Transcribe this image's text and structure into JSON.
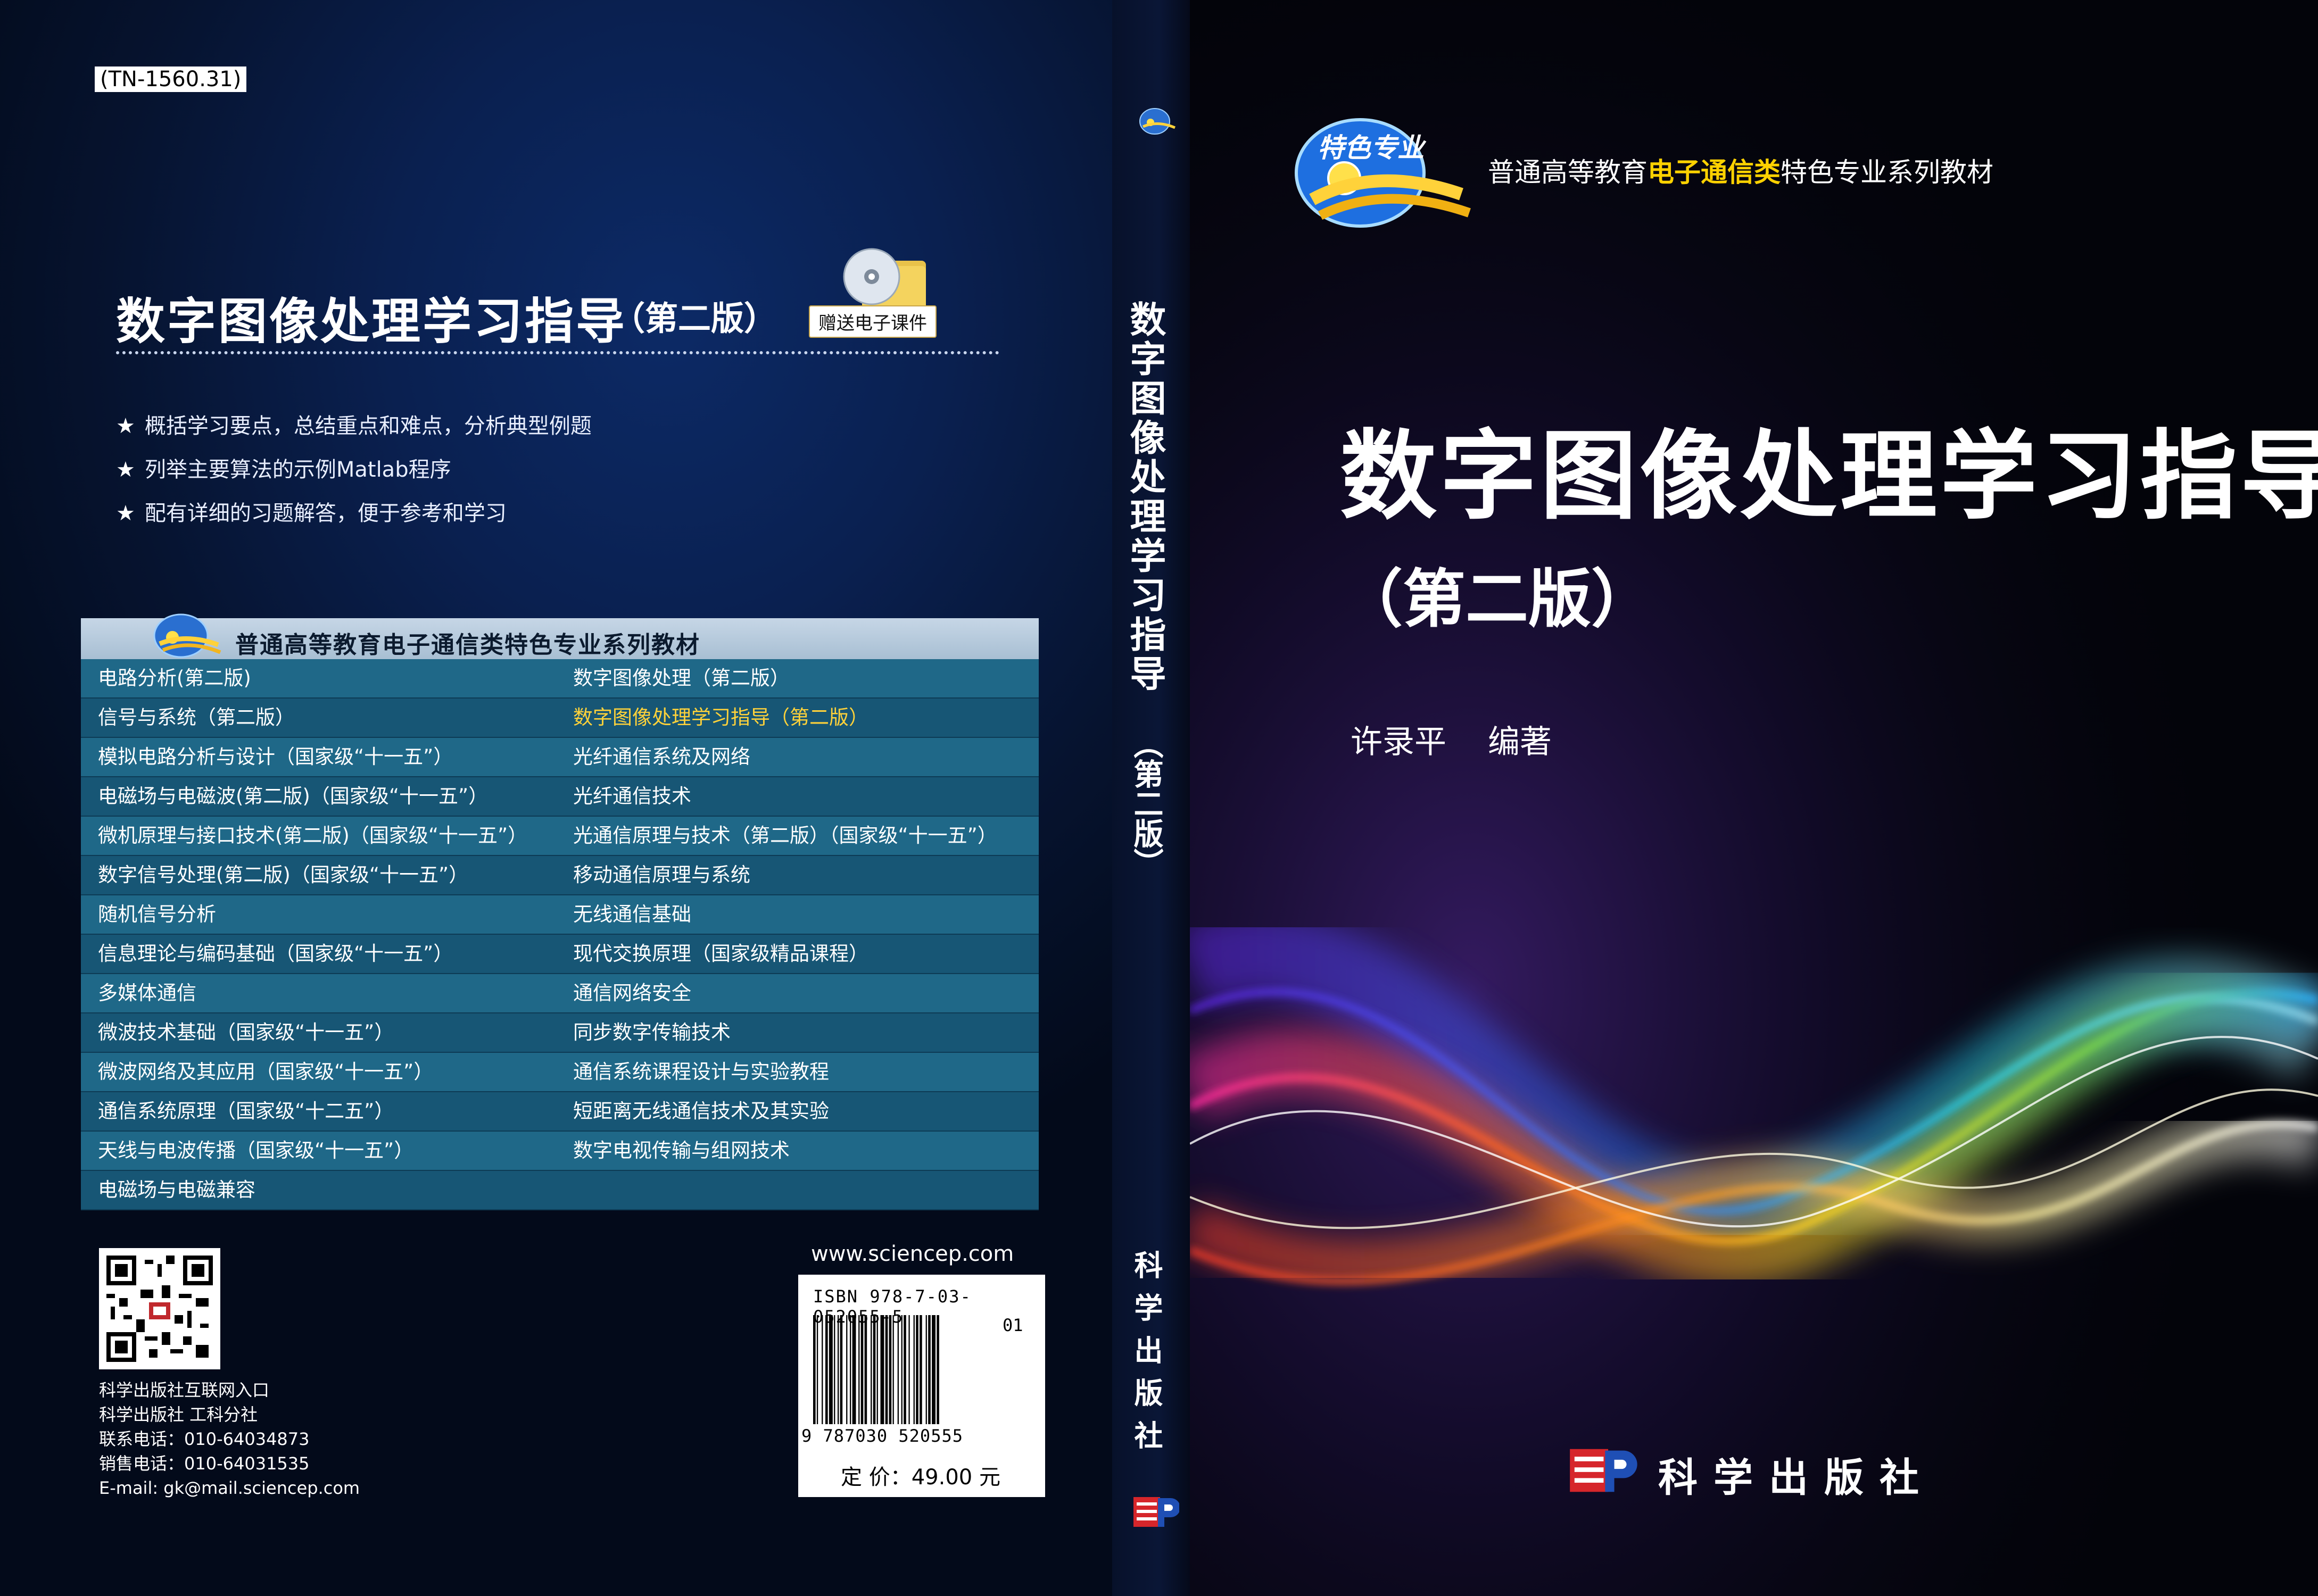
{
  "back": {
    "catalog_code": "(TN-1560.31)",
    "title": "数字图像处理学习指导",
    "edition": "（第二版）",
    "cd_label": "赠送电子课件",
    "features": [
      "概括学习要点，总结重点和难点，分析典型例题",
      "列举主要算法的示例Matlab程序",
      "配有详细的习题解答，便于参考和学习"
    ],
    "feature_bullet": "★",
    "series_header": "普通高等教育电子通信类特色专业系列教材",
    "series_rows": [
      [
        "电路分析(第二版)",
        "数字图像处理（第二版）"
      ],
      [
        "信号与系统（第二版）",
        "数字图像处理学习指导（第二版）"
      ],
      [
        "模拟电路分析与设计（国家级“十一五”）",
        "光纤通信系统及网络"
      ],
      [
        "电磁场与电磁波(第二版)（国家级“十一五”）",
        "光纤通信技术"
      ],
      [
        "微机原理与接口技术(第二版)（国家级“十一五”）",
        "光通信原理与技术（第二版）（国家级“十一五”）"
      ],
      [
        "数字信号处理(第二版)（国家级“十一五”）",
        "移动通信原理与系统"
      ],
      [
        "随机信号分析",
        "无线通信基础"
      ],
      [
        "信息理论与编码基础（国家级“十一五”）",
        "现代交换原理（国家级精品课程）"
      ],
      [
        "多媒体通信",
        "通信网络安全"
      ],
      [
        "微波技术基础（国家级“十一五”）",
        "同步数字传输技术"
      ],
      [
        "微波网络及其应用（国家级“十一五”）",
        "通信系统课程设计与实验教程"
      ],
      [
        "通信系统原理（国家级“十二五”）",
        "短距离无线通信技术及其实验"
      ],
      [
        "天线与电波传播（国家级“十一五”）",
        "数字电视传输与组网技术"
      ],
      [
        "电磁场与电磁兼容",
        ""
      ]
    ],
    "highlight_color": "#ffd23a",
    "contact": [
      "科学出版社互联网入口",
      "科学出版社 工科分社",
      "联系电话：010-64034873",
      "销售电话：010-64031535",
      "E-mail: gk@mail.sciencep.com"
    ],
    "url": "www.sciencep.com",
    "isbn": "ISBN 978-7-03-052055-5",
    "barcode_addon": "01",
    "barcode_number": "9 787030 520555",
    "price": "定 价：49.00 元"
  },
  "spine": {
    "title": "数字图像处理学习指导",
    "edition": "（第二版）",
    "publisher": "科学出版社"
  },
  "front": {
    "badge_text": "特色专业",
    "series_prefix": "普通高等教育",
    "series_emphasis": "电子通信类",
    "series_suffix": "特色专业系列教材",
    "title": "数字图像处理学习指导",
    "edition": "（第二版）",
    "author": "许录平",
    "author_role": "编著",
    "publisher": "科学出版社",
    "accent_color": "#ffd200"
  }
}
